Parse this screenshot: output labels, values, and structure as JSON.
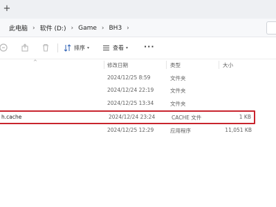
{
  "tabstrip": {
    "new_tab_label": "+"
  },
  "breadcrumb": {
    "items": [
      "此电脑",
      "软件 (D:)",
      "Game",
      "BH3"
    ],
    "separator": "›"
  },
  "commandbar": {
    "sort_label": "排序",
    "view_label": "查看",
    "more_label": "···"
  },
  "columns": {
    "date": "修改日期",
    "type": "类型",
    "size": "大小"
  },
  "rows": [
    {
      "name": "",
      "date": "2024/12/25 8:59",
      "type": "文件夹",
      "size": ""
    },
    {
      "name": "",
      "date": "2024/12/24 22:19",
      "type": "文件夹",
      "size": ""
    },
    {
      "name": "",
      "date": "2024/12/25 13:34",
      "type": "文件夹",
      "size": ""
    },
    {
      "name": "h.cache",
      "date": "2024/12/24 23:24",
      "type": "CACHE 文件",
      "size": "1 KB"
    },
    {
      "name": "",
      "date": "2024/12/25 12:29",
      "type": "应用程序",
      "size": "11,051 KB"
    }
  ],
  "colors": {
    "highlight_border": "#c8232c",
    "tabstrip_bg": "#eef0f3"
  }
}
